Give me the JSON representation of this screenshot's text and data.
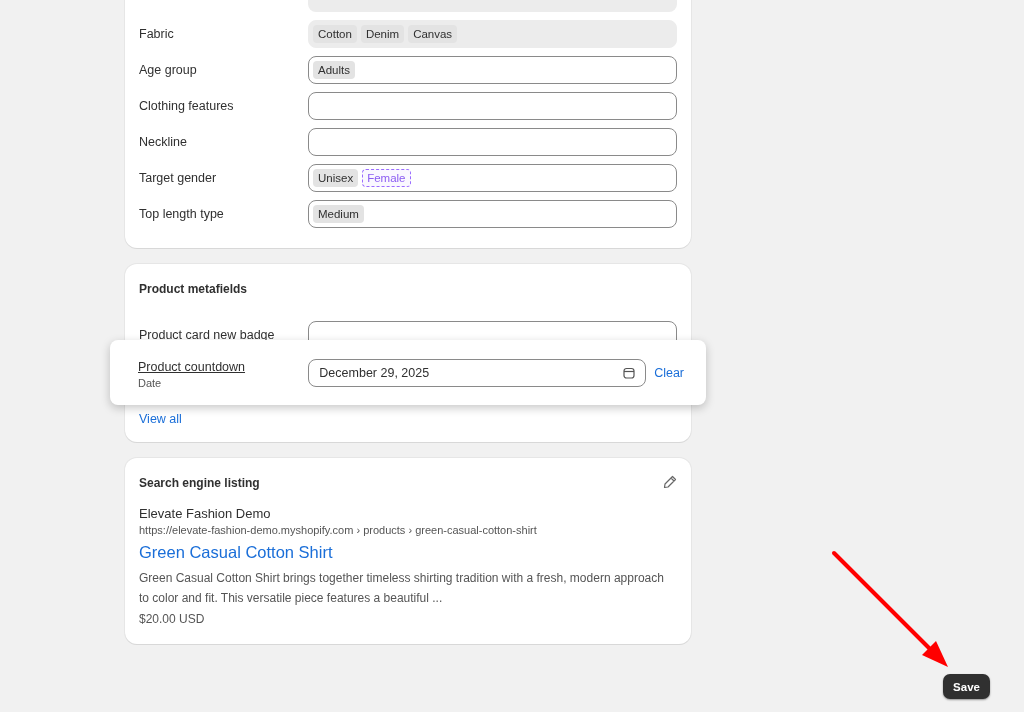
{
  "attributes": {
    "rows": [
      {
        "label": "Fabric",
        "disabled": true,
        "chips": [
          {
            "text": "Cotton",
            "kind": "value"
          },
          {
            "text": "Denim",
            "kind": "value"
          },
          {
            "text": "Canvas",
            "kind": "value"
          }
        ]
      },
      {
        "label": "Age group",
        "disabled": false,
        "chips": [
          {
            "text": "Adults",
            "kind": "value"
          }
        ]
      },
      {
        "label": "Clothing features",
        "disabled": false,
        "chips": []
      },
      {
        "label": "Neckline",
        "disabled": false,
        "chips": []
      },
      {
        "label": "Target gender",
        "disabled": false,
        "chips": [
          {
            "text": "Unisex",
            "kind": "value"
          },
          {
            "text": "Female",
            "kind": "suggestion"
          }
        ]
      },
      {
        "label": "Top length type",
        "disabled": false,
        "chips": [
          {
            "text": "Medium",
            "kind": "value"
          }
        ]
      }
    ]
  },
  "metafields": {
    "title": "Product metafields",
    "rows": [
      {
        "label": "Product card new badge"
      }
    ],
    "popup": {
      "label": "Product countdown",
      "type": "Date",
      "value": "December 29, 2025",
      "action": "Clear"
    },
    "view_all": "View all"
  },
  "seo": {
    "title": "Search engine listing",
    "store": "Elevate Fashion Demo",
    "url": "https://elevate-fashion-demo.myshopify.com › products › green-casual-cotton-shirt",
    "page_title": "Green Casual Cotton Shirt",
    "description": "Green Casual Cotton Shirt brings together timeless shirting tradition with a fresh, modern approach to color and fit. This versatile piece features a beautiful ...",
    "price": "$20.00 USD"
  },
  "save_button": "Save"
}
